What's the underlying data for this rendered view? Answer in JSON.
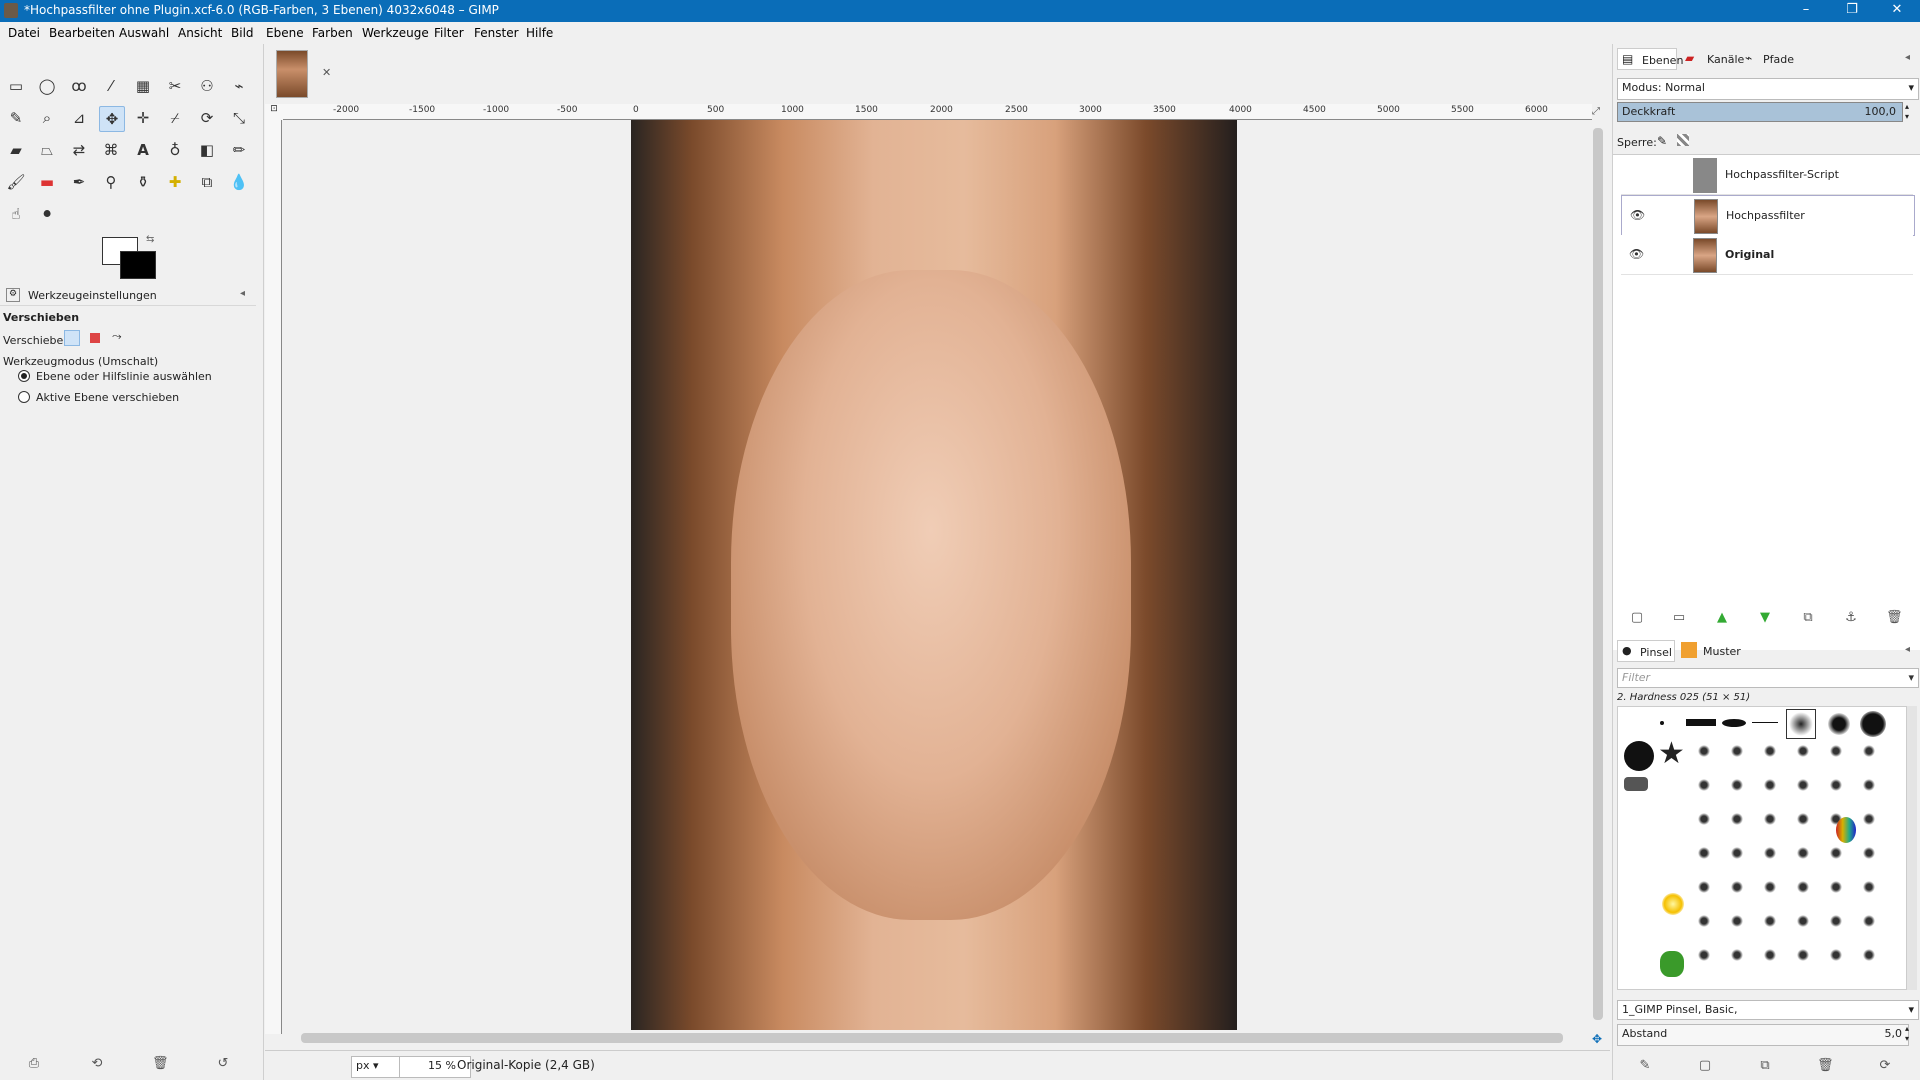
{
  "window": {
    "title": "*Hochpassfilter ohne Plugin.xcf-6.0 (RGB-Farben, 3 Ebenen) 4032x6048 – GIMP"
  },
  "menu": [
    "Datei",
    "Bearbeiten",
    "Auswahl",
    "Ansicht",
    "Bild",
    "Ebene",
    "Farben",
    "Werkzeuge",
    "Filter",
    "Fenster",
    "Hilfe"
  ],
  "toolbox": {
    "tool_options_tab": "Werkzeugeinstellungen",
    "tool_name": "Verschieben",
    "move_label": "Verschieben:",
    "mode_label": "Werkzeugmodus (Umschalt)",
    "radio_options": [
      "Ebene oder Hilfslinie auswählen",
      "Aktive Ebene verschieben"
    ],
    "selected_radio": 0
  },
  "ruler": {
    "labels": [
      "-2000",
      "-1500",
      "-1000",
      "-500",
      "0",
      "500",
      "1000",
      "1500",
      "2000",
      "2500",
      "3000",
      "3500",
      "4000",
      "4500",
      "5000",
      "5500",
      "6000"
    ]
  },
  "status": {
    "unit": "px",
    "zoom": "15 %",
    "info": "Original-Kopie (2,4 GB)"
  },
  "layers_panel": {
    "tabs": [
      "Ebenen",
      "Kanäle",
      "Pfade"
    ],
    "mode": "Modus: Normal",
    "opacity_label": "Deckkraft",
    "opacity_value": "100,0",
    "lock_label": "Sperre:",
    "layers": [
      {
        "name": "Hochpassfilter-Script",
        "visible": false,
        "bold": false
      },
      {
        "name": "Hochpassfilter",
        "visible": true,
        "bold": false
      },
      {
        "name": "Original",
        "visible": true,
        "bold": true
      }
    ]
  },
  "brushes_panel": {
    "tabs": [
      "Pinsel",
      "Muster"
    ],
    "filter_placeholder": "Filter",
    "selected_brush": "2. Hardness 025 (51 × 51)",
    "brush_set": "1_GIMP Pinsel, Basic,",
    "spacing_label": "Abstand",
    "spacing_value": "5,0"
  }
}
